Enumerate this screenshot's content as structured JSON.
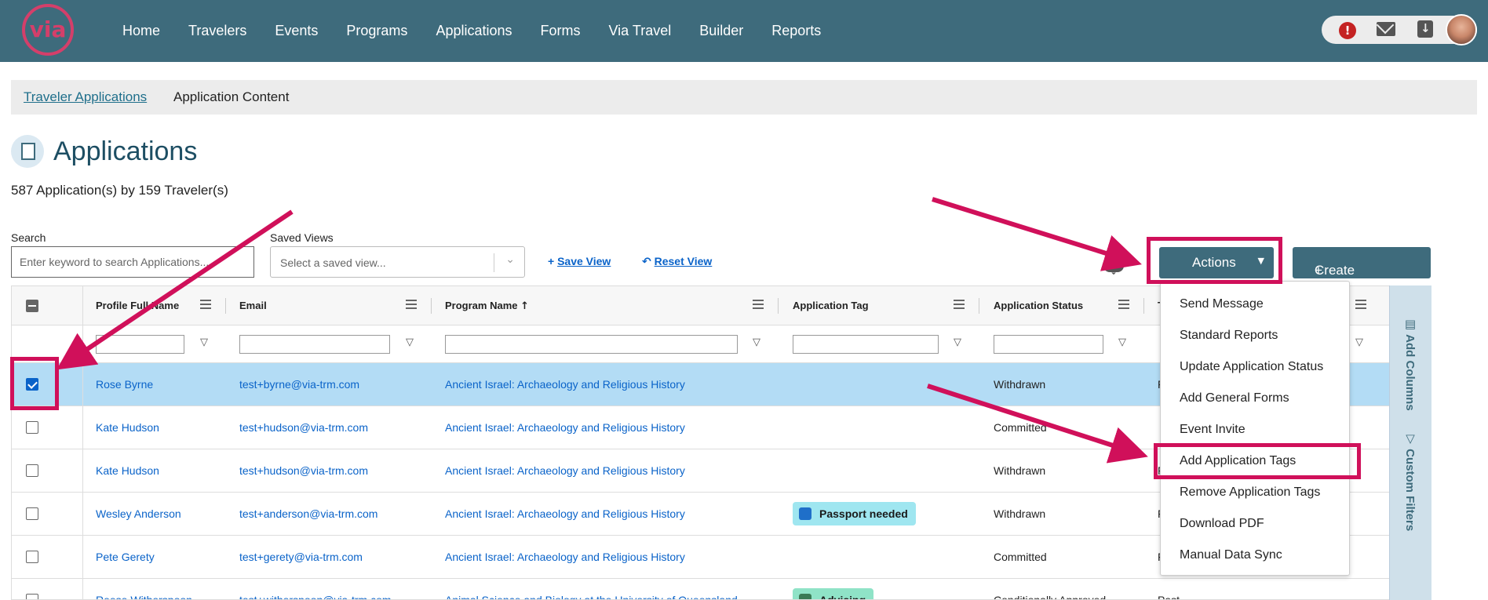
{
  "nav": {
    "logo_text": "via",
    "items": [
      "Home",
      "Travelers",
      "Events",
      "Programs",
      "Applications",
      "Forms",
      "Via Travel",
      "Builder",
      "Reports"
    ],
    "alert_text": "!"
  },
  "subnav": {
    "link": "Traveler Applications",
    "current": "Application Content"
  },
  "page": {
    "title": "Applications",
    "count": "587 Application(s) by 159 Traveler(s)"
  },
  "controls": {
    "search_label": "Search",
    "search_placeholder": "Enter keyword to search Applications...",
    "saved_views_label": "Saved Views",
    "saved_views_placeholder": "Select a saved view...",
    "save_view": "Save View",
    "reset_view": "Reset View",
    "actions": "Actions",
    "create_template": "Create Template"
  },
  "columns": [
    "Profile Full Name",
    "Email",
    "Program Name",
    "Application Tag",
    "Application Status",
    "T"
  ],
  "rows": [
    {
      "name": "Rose Byrne",
      "email": "test+byrne@via-trm.com",
      "program": "Ancient Israel: Archaeology and Religious History",
      "tag": "",
      "status": "Withdrawn",
      "extra": "F",
      "selected": true
    },
    {
      "name": "Kate Hudson",
      "email": "test+hudson@via-trm.com",
      "program": "Ancient Israel: Archaeology and Religious History",
      "tag": "",
      "status": "Committed",
      "extra": "",
      "selected": false
    },
    {
      "name": "Kate Hudson",
      "email": "test+hudson@via-trm.com",
      "program": "Ancient Israel: Archaeology and Religious History",
      "tag": "",
      "status": "Withdrawn",
      "extra": "F",
      "selected": false
    },
    {
      "name": "Wesley Anderson",
      "email": "test+anderson@via-trm.com",
      "program": "Ancient Israel: Archaeology and Religious History",
      "tag": "Passport needed",
      "status": "Withdrawn",
      "extra": "F",
      "selected": false
    },
    {
      "name": "Pete Gerety",
      "email": "test+gerety@via-trm.com",
      "program": "Ancient Israel: Archaeology and Religious History",
      "tag": "",
      "status": "Committed",
      "extra": "F",
      "selected": false
    },
    {
      "name": "Reese Witherspoon",
      "email": "test+witherspoon@via-trm.com",
      "program": "Animal Science and Biology at the University of Queensland",
      "tag": "Advising",
      "status": "Conditionally Approved",
      "extra": "Past",
      "selected": false
    }
  ],
  "actions_menu": [
    "Send Message",
    "Standard Reports",
    "Update Application Status",
    "Add General Forms",
    "Event Invite",
    "Add Application Tags",
    "Remove Application Tags",
    "Download PDF",
    "Manual Data Sync"
  ],
  "side_panel": {
    "add_columns": "Add Columns",
    "custom_filters": "Custom Filters"
  },
  "colors": {
    "nav_bg": "#3e6b7c",
    "accent": "#d0105a",
    "link": "#0a63c9",
    "selected_row": "#b3dcf5"
  }
}
